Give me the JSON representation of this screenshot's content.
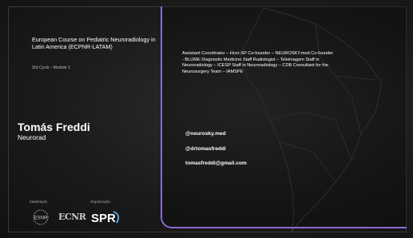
{
  "course": {
    "title": "European Course on Pediatric Neuroradiology in Latin America (ECPNR-LATAM)",
    "subtitle": "3rd Cycle - Module 1"
  },
  "speaker": {
    "name": "Tomás Freddi",
    "role": "Neurorad",
    "bio": "Assistant Coordinator – Hcor-SP Co-founder – NEUROSKY.med Co-founder - BLUME Diagnostic Medicine Staff Radiologist – Teleimagem Staff in Neuroradiology – ICESP Staff in Neuroradiology – CDB Consultant for the Neurosurgery Team – IAMSPE"
  },
  "contacts": {
    "instagram1": "@neurosky.med",
    "instagram2": "@drtomasfreddi",
    "email": "tomasfreddi@gmail.com"
  },
  "footer": {
    "realizacao_label": "Idealização",
    "organizacao_label": "Organização",
    "logos": [
      "esnr-logo",
      "ecnr-logo",
      "spr-logo"
    ],
    "logo_texts": {
      "ecnr": "ECNR",
      "spr": "SPR"
    }
  },
  "colors": {
    "background": "#1b1b1b",
    "accent": "#8a6ad0",
    "text": "#ffffff"
  }
}
